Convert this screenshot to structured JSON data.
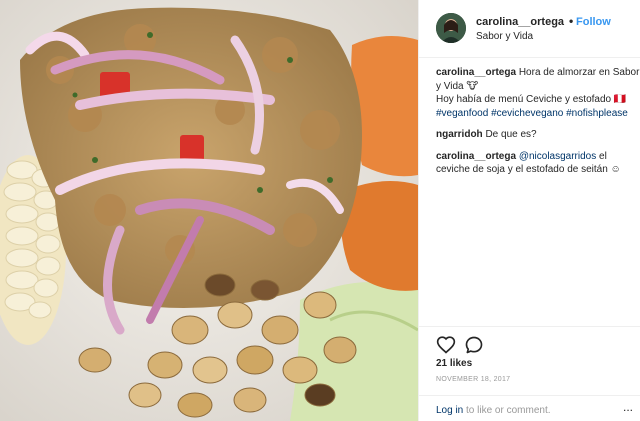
{
  "photo": {
    "alt_icon": "food-photo",
    "colors": {
      "plate": "#efece7",
      "corn": "#f4ecd0",
      "sweet_potato": "#e9863c",
      "lettuce": "#d9e7b8",
      "onion": "#c98cb6",
      "ceviche": "#b9925f",
      "tostado": "#d9b57a"
    }
  },
  "post": {
    "author": "carolina__ortega",
    "separator": "•",
    "follow_label": "Follow",
    "location": "Sabor y Vida",
    "likes": "21 likes",
    "date": "NOVEMBER 18, 2017"
  },
  "comments": [
    {
      "user": "carolina__ortega",
      "text": "Hora de almorzar en Sabor y Vida 🐮",
      "line2": "Hoy había de menú Ceviche y estofado 🇵🇪",
      "tags": [
        "#veganfood",
        "#cevichevegano",
        "#nofishplease"
      ]
    },
    {
      "user": "ngarridoh",
      "text": "De que es?"
    },
    {
      "user": "carolina__ortega",
      "mention": "@nicolasgarridos",
      "text": "el ceviche de soja y el estofado de seitán ☺"
    }
  ],
  "actions": {
    "like_icon": "heart-icon",
    "comment_icon": "comment-icon"
  },
  "footer": {
    "login_link": "Log in",
    "login_suffix": "to like or comment.",
    "more_label": "..."
  }
}
